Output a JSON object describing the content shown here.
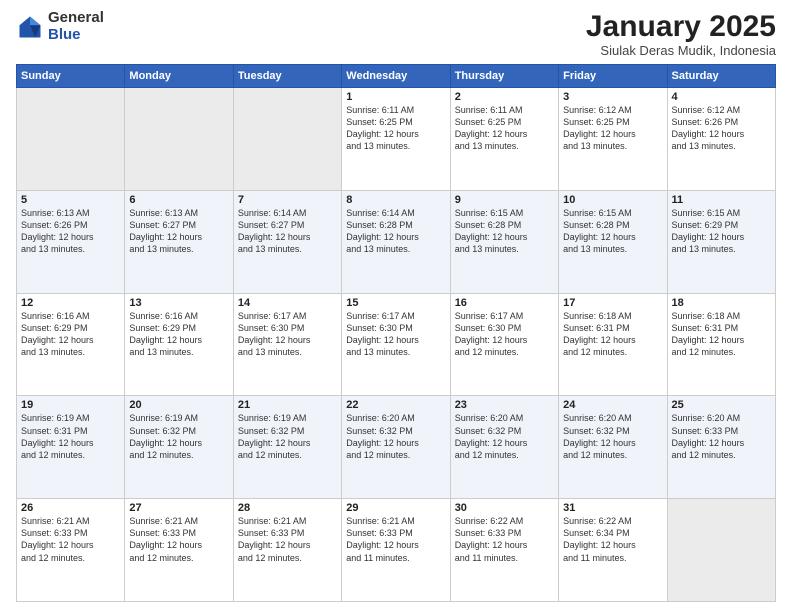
{
  "header": {
    "logo_general": "General",
    "logo_blue": "Blue",
    "month_title": "January 2025",
    "subtitle": "Siulak Deras Mudik, Indonesia"
  },
  "weekdays": [
    "Sunday",
    "Monday",
    "Tuesday",
    "Wednesday",
    "Thursday",
    "Friday",
    "Saturday"
  ],
  "weeks": [
    [
      {
        "day": "",
        "info": ""
      },
      {
        "day": "",
        "info": ""
      },
      {
        "day": "",
        "info": ""
      },
      {
        "day": "1",
        "info": "Sunrise: 6:11 AM\nSunset: 6:25 PM\nDaylight: 12 hours\nand 13 minutes."
      },
      {
        "day": "2",
        "info": "Sunrise: 6:11 AM\nSunset: 6:25 PM\nDaylight: 12 hours\nand 13 minutes."
      },
      {
        "day": "3",
        "info": "Sunrise: 6:12 AM\nSunset: 6:25 PM\nDaylight: 12 hours\nand 13 minutes."
      },
      {
        "day": "4",
        "info": "Sunrise: 6:12 AM\nSunset: 6:26 PM\nDaylight: 12 hours\nand 13 minutes."
      }
    ],
    [
      {
        "day": "5",
        "info": "Sunrise: 6:13 AM\nSunset: 6:26 PM\nDaylight: 12 hours\nand 13 minutes."
      },
      {
        "day": "6",
        "info": "Sunrise: 6:13 AM\nSunset: 6:27 PM\nDaylight: 12 hours\nand 13 minutes."
      },
      {
        "day": "7",
        "info": "Sunrise: 6:14 AM\nSunset: 6:27 PM\nDaylight: 12 hours\nand 13 minutes."
      },
      {
        "day": "8",
        "info": "Sunrise: 6:14 AM\nSunset: 6:28 PM\nDaylight: 12 hours\nand 13 minutes."
      },
      {
        "day": "9",
        "info": "Sunrise: 6:15 AM\nSunset: 6:28 PM\nDaylight: 12 hours\nand 13 minutes."
      },
      {
        "day": "10",
        "info": "Sunrise: 6:15 AM\nSunset: 6:28 PM\nDaylight: 12 hours\nand 13 minutes."
      },
      {
        "day": "11",
        "info": "Sunrise: 6:15 AM\nSunset: 6:29 PM\nDaylight: 12 hours\nand 13 minutes."
      }
    ],
    [
      {
        "day": "12",
        "info": "Sunrise: 6:16 AM\nSunset: 6:29 PM\nDaylight: 12 hours\nand 13 minutes."
      },
      {
        "day": "13",
        "info": "Sunrise: 6:16 AM\nSunset: 6:29 PM\nDaylight: 12 hours\nand 13 minutes."
      },
      {
        "day": "14",
        "info": "Sunrise: 6:17 AM\nSunset: 6:30 PM\nDaylight: 12 hours\nand 13 minutes."
      },
      {
        "day": "15",
        "info": "Sunrise: 6:17 AM\nSunset: 6:30 PM\nDaylight: 12 hours\nand 13 minutes."
      },
      {
        "day": "16",
        "info": "Sunrise: 6:17 AM\nSunset: 6:30 PM\nDaylight: 12 hours\nand 12 minutes."
      },
      {
        "day": "17",
        "info": "Sunrise: 6:18 AM\nSunset: 6:31 PM\nDaylight: 12 hours\nand 12 minutes."
      },
      {
        "day": "18",
        "info": "Sunrise: 6:18 AM\nSunset: 6:31 PM\nDaylight: 12 hours\nand 12 minutes."
      }
    ],
    [
      {
        "day": "19",
        "info": "Sunrise: 6:19 AM\nSunset: 6:31 PM\nDaylight: 12 hours\nand 12 minutes."
      },
      {
        "day": "20",
        "info": "Sunrise: 6:19 AM\nSunset: 6:32 PM\nDaylight: 12 hours\nand 12 minutes."
      },
      {
        "day": "21",
        "info": "Sunrise: 6:19 AM\nSunset: 6:32 PM\nDaylight: 12 hours\nand 12 minutes."
      },
      {
        "day": "22",
        "info": "Sunrise: 6:20 AM\nSunset: 6:32 PM\nDaylight: 12 hours\nand 12 minutes."
      },
      {
        "day": "23",
        "info": "Sunrise: 6:20 AM\nSunset: 6:32 PM\nDaylight: 12 hours\nand 12 minutes."
      },
      {
        "day": "24",
        "info": "Sunrise: 6:20 AM\nSunset: 6:32 PM\nDaylight: 12 hours\nand 12 minutes."
      },
      {
        "day": "25",
        "info": "Sunrise: 6:20 AM\nSunset: 6:33 PM\nDaylight: 12 hours\nand 12 minutes."
      }
    ],
    [
      {
        "day": "26",
        "info": "Sunrise: 6:21 AM\nSunset: 6:33 PM\nDaylight: 12 hours\nand 12 minutes."
      },
      {
        "day": "27",
        "info": "Sunrise: 6:21 AM\nSunset: 6:33 PM\nDaylight: 12 hours\nand 12 minutes."
      },
      {
        "day": "28",
        "info": "Sunrise: 6:21 AM\nSunset: 6:33 PM\nDaylight: 12 hours\nand 12 minutes."
      },
      {
        "day": "29",
        "info": "Sunrise: 6:21 AM\nSunset: 6:33 PM\nDaylight: 12 hours\nand 11 minutes."
      },
      {
        "day": "30",
        "info": "Sunrise: 6:22 AM\nSunset: 6:33 PM\nDaylight: 12 hours\nand 11 minutes."
      },
      {
        "day": "31",
        "info": "Sunrise: 6:22 AM\nSunset: 6:34 PM\nDaylight: 12 hours\nand 11 minutes."
      },
      {
        "day": "",
        "info": ""
      }
    ]
  ]
}
